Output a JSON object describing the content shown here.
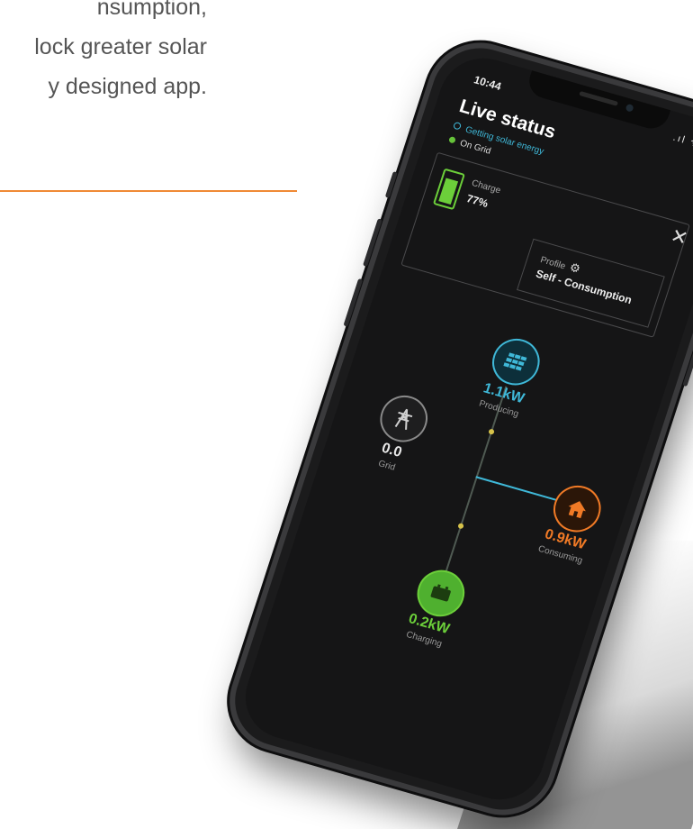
{
  "marketing": {
    "line1": "nsumption,",
    "line2": "lock greater solar",
    "line3": "y designed app."
  },
  "app": {
    "time": "10:44",
    "status_icons": ".ıl ᯤ ▬",
    "title": "Live status",
    "substatus": "Getting solar energy",
    "grid_status": "On Grid",
    "close_label": "✕",
    "charge": {
      "label": "Charge",
      "value": "77%",
      "level": 0.77
    },
    "profile": {
      "label": "Profile",
      "value": "Self - Consumption",
      "gear": "⚙"
    },
    "nodes": {
      "producing": {
        "value": "1.1kW",
        "label": "Producing",
        "icon": "solar-panel-icon"
      },
      "grid": {
        "value": "0.0",
        "label": "Grid",
        "icon": "power-tower-icon"
      },
      "consuming": {
        "value": "0.9kW",
        "label": "Consuming",
        "icon": "house-icon"
      },
      "charging": {
        "value": "0.2kW",
        "label": "Charging",
        "icon": "battery-icon"
      }
    },
    "colors": {
      "accent_cyan": "#3fb8d8",
      "accent_orange": "#f07a26",
      "accent_green": "#6ccf3a"
    }
  }
}
